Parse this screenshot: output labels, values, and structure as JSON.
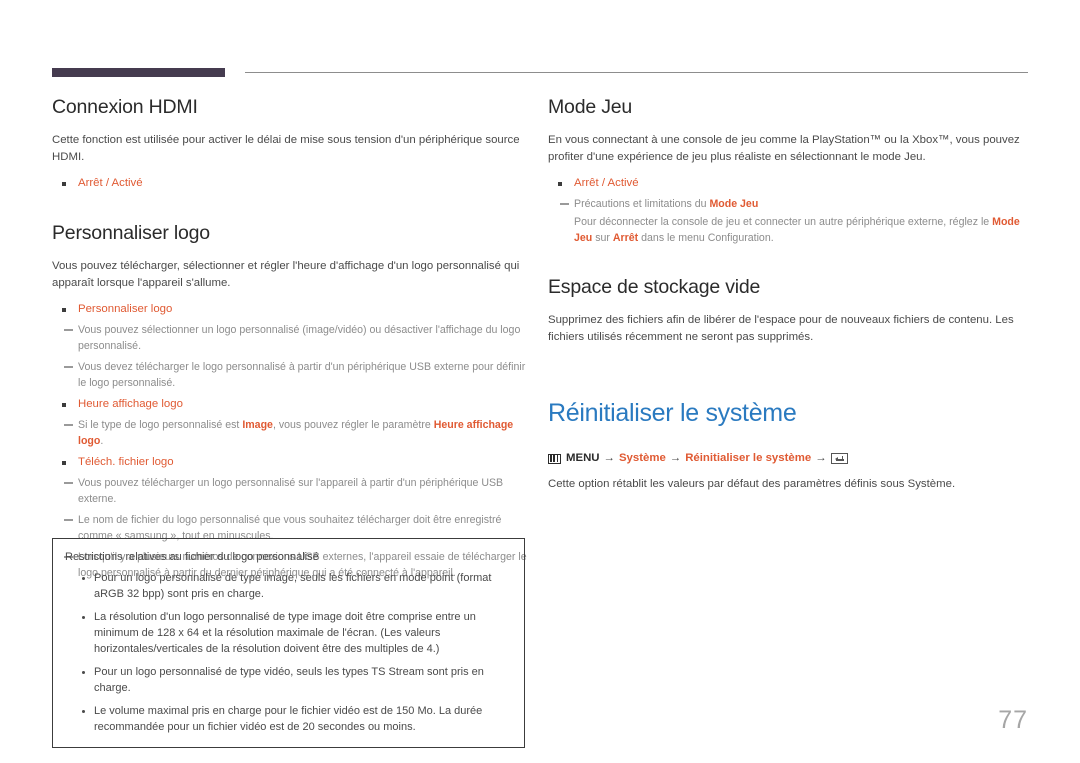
{
  "page": {
    "number": "77",
    "accent_purple": "#453b4f",
    "accent_orange": "#e05a33",
    "accent_blue": "#2a7ac0",
    "body_text": "#4a4a4a"
  },
  "left_column": {
    "section1": {
      "heading": "Connexion HDMI",
      "paragraph": "Cette fonction est utilisée pour activer le délai de mise sous tension d'un périphérique source HDMI.",
      "options": [
        "Arrêt / Activé"
      ]
    },
    "section2": {
      "heading": "Personnaliser logo",
      "paragraph": "Vous pouvez télécharger, sélectionner et régler l'heure d'affichage d'un logo personnalisé qui apparaît lorsque l'appareil s'allume.",
      "items": [
        {
          "label": "Personnaliser logo",
          "notes": [
            "Vous pouvez sélectionner un logo personnalisé (image/vidéo) ou désactiver l'affichage du logo personnalisé.",
            "Vous devez télécharger le logo personnalisé à partir d'un périphérique USB externe pour définir le logo personnalisé."
          ]
        },
        {
          "label": "Heure affichage logo",
          "notes_rich": [
            {
              "prefix": "Si le type de logo personnalisé est ",
              "hl1": "Image",
              "mid": ", vous pouvez régler le paramètre ",
              "hl2": "Heure affichage logo",
              "suffix": "."
            }
          ]
        },
        {
          "label": "Téléch. fichier logo",
          "notes": [
            "Vous pouvez télécharger un logo personnalisé sur l'appareil à partir d'un périphérique USB externe.",
            "Le nom de fichier du logo personnalisé que vous souhaitez télécharger doit être enregistré comme « samsung », tout en minuscules.",
            "Lorsqu'il y a plusieurs numéros de connexions USB externes, l'appareil essaie de télécharger le logo personnalisé à partir du dernier périphérique qui a été connecté à l'appareil."
          ]
        }
      ]
    },
    "notebox": {
      "title": "Restrictions relatives au fichier du logo personnalisé",
      "bullets": [
        "Pour un logo personnalisé de type image, seuls les fichiers en mode point (format aRGB 32 bpp) sont pris en charge.",
        "La résolution d'un logo personnalisé de type image doit être comprise entre un minimum de 128 x 64 et la résolution maximale de l'écran. (Les valeurs horizontales/verticales de la résolution doivent être des multiples de 4.)",
        "Pour un logo personnalisé de type vidéo, seuls les types TS Stream sont pris en charge.",
        "Le volume maximal pris en charge pour le fichier vidéo est de 150 Mo. La durée recommandée pour un fichier vidéo est de 20 secondes ou moins."
      ]
    }
  },
  "right_column": {
    "section1": {
      "heading": "Mode Jeu",
      "paragraph": "En vous connectant à une console de jeu comme la PlayStation™ ou la Xbox™, vous pouvez profiter d'une expérience de jeu plus réaliste en sélectionnant le mode Jeu.",
      "options": [
        "Arrêt / Activé"
      ],
      "note_line1_prefix": "Précautions et limitations du ",
      "note_line1_hl": "Mode Jeu",
      "note_line2_a": "Pour déconnecter la console de jeu et connecter un autre périphérique externe, réglez le ",
      "note_line2_hl1": "Mode Jeu",
      "note_line2_b": " sur ",
      "note_line2_hl2": "Arrêt",
      "note_line2_c": " dans le menu Configuration."
    },
    "section2": {
      "heading": "Espace de stockage vide",
      "paragraph": "Supprimez des fichiers afin de libérer de l'espace pour de nouveaux fichiers de contenu. Les fichiers utilisés récemment ne seront pas supprimés."
    },
    "section3": {
      "heading": "Réinitialiser le système",
      "menu_label": "MENU",
      "arrow": "→",
      "path_item1": "Système",
      "path_item2": "Réinitialiser le système",
      "paragraph": "Cette option rétablit les valeurs par défaut des paramètres définis sous Système."
    }
  }
}
